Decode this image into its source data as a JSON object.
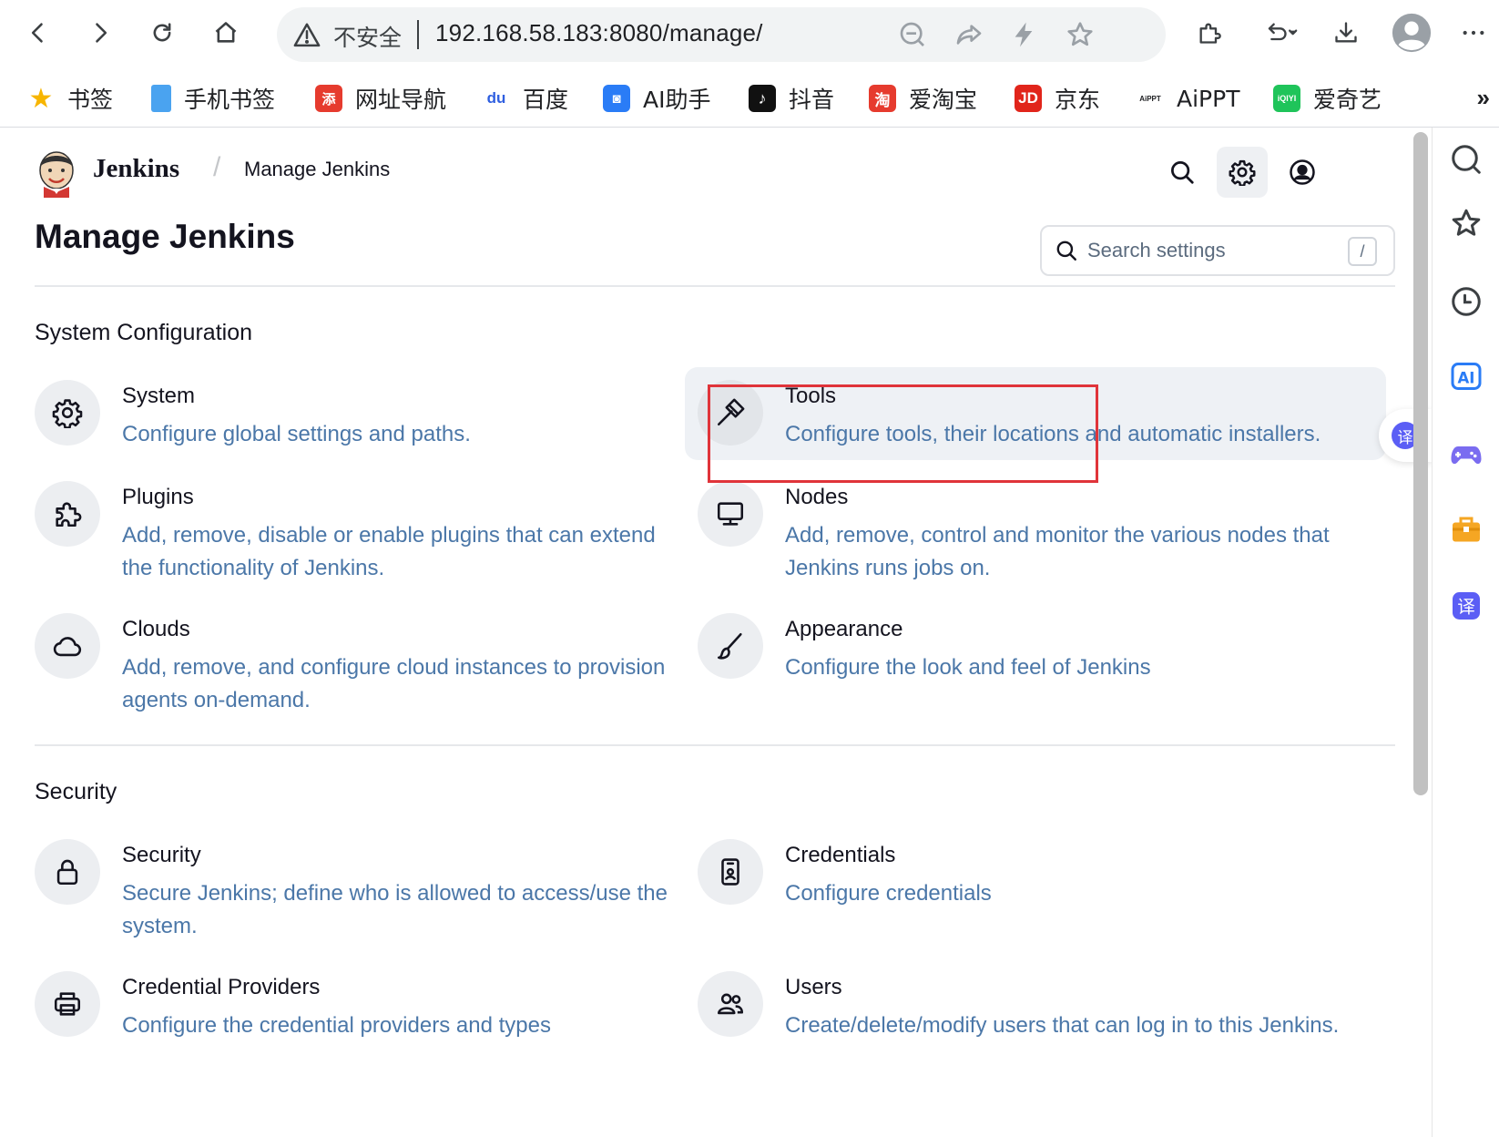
{
  "browser": {
    "insecure_label": "不安全",
    "url": "192.168.58.183:8080/manage/",
    "bookmarks": [
      {
        "label": "书签",
        "icon": "star-icon",
        "glyph": "★",
        "color": "#f7b500"
      },
      {
        "label": "手机书签",
        "icon": "phone-bookmark-icon",
        "glyph": "",
        "color": "#4aa3f0"
      },
      {
        "label": "网址导航",
        "icon": "nav-site-icon",
        "glyph": "添",
        "color": "#e63b2e"
      },
      {
        "label": "百度",
        "icon": "baidu-icon",
        "glyph": "du",
        "color": "#2f5fe0"
      },
      {
        "label": "AI助手",
        "icon": "ai-assistant-icon",
        "glyph": "◙",
        "color": "#2a7cf6"
      },
      {
        "label": "抖音",
        "icon": "douyin-icon",
        "glyph": "♪",
        "color": "#111111"
      },
      {
        "label": "爱淘宝",
        "icon": "taobao-icon",
        "glyph": "淘",
        "color": "#e63b2e"
      },
      {
        "label": "京东",
        "icon": "jd-icon",
        "glyph": "JD",
        "color": "#e1251b"
      },
      {
        "label": "AiPPT",
        "icon": "aippt-icon",
        "glyph": "AiPPT",
        "color": "#ffffff"
      },
      {
        "label": "爱奇艺",
        "icon": "iqiyi-icon",
        "glyph": "iQIYI",
        "color": "#1fc45a"
      }
    ],
    "more_bookmarks": "»",
    "translate_glyph": "译",
    "sidebar_ai_label": "AI",
    "sidebar_translate_glyph": "译"
  },
  "header": {
    "brand": "Jenkins",
    "breadcrumb": "Manage Jenkins"
  },
  "page": {
    "title": "Manage Jenkins",
    "search_placeholder": "Search settings",
    "search_shortcut": "/"
  },
  "sections": [
    {
      "title": "System Configuration",
      "items": [
        {
          "name": "System",
          "desc": "Configure global settings and paths.",
          "icon": "gear-icon"
        },
        {
          "name": "Tools",
          "desc": "Configure tools, their locations and automatic installers.",
          "icon": "hammer-icon"
        },
        {
          "name": "Plugins",
          "desc": "Add, remove, disable or enable plugins that can extend the functionality of Jenkins.",
          "icon": "puzzle-icon"
        },
        {
          "name": "Nodes",
          "desc": "Add, remove, control and monitor the various nodes that Jenkins runs jobs on.",
          "icon": "monitor-icon"
        },
        {
          "name": "Clouds",
          "desc": "Add, remove, and configure cloud instances to provision agents on-demand.",
          "icon": "cloud-icon"
        },
        {
          "name": "Appearance",
          "desc": "Configure the look and feel of Jenkins",
          "icon": "brush-icon"
        }
      ]
    },
    {
      "title": "Security",
      "items": [
        {
          "name": "Security",
          "desc": "Secure Jenkins; define who is allowed to access/use the system.",
          "icon": "lock-icon"
        },
        {
          "name": "Credentials",
          "desc": "Configure credentials",
          "icon": "id-card-icon"
        },
        {
          "name": "Credential Providers",
          "desc": "Configure the credential providers and types",
          "icon": "printer-icon"
        },
        {
          "name": "Users",
          "desc": "Create/delete/modify users that can log in to this Jenkins.",
          "icon": "users-icon"
        }
      ]
    }
  ],
  "colors": {
    "link_blue": "#4b77a8",
    "highlight_red": "#e0343a",
    "tile_hover": "#eef1f5"
  }
}
